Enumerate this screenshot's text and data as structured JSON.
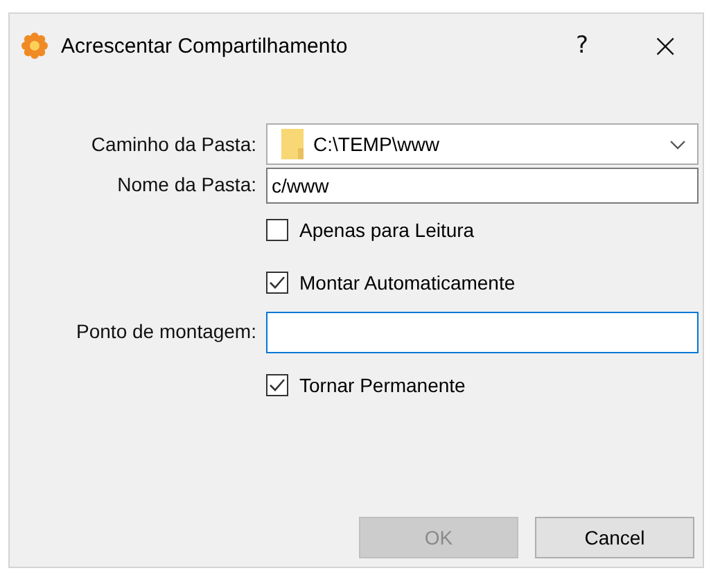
{
  "window": {
    "title": "Acrescentar Compartilhamento",
    "help": "?",
    "close": "×"
  },
  "form": [
    {
      "kind": "combo",
      "label": "Caminho da Pasta:",
      "value": "C:\\TEMP\\www",
      "focused": false
    },
    {
      "kind": "text",
      "label": "Nome da Pasta:",
      "value": "c/www",
      "focused": false
    },
    {
      "kind": "check",
      "label": "Apenas para Leitura",
      "checked": false
    },
    {
      "kind": "check",
      "label": "Montar Automaticamente",
      "checked": true
    },
    {
      "kind": "text",
      "label": "Ponto de montagem:",
      "focused": true
    },
    {
      "kind": "check",
      "label": "Tornar Permanente",
      "checked": true
    }
  ],
  "buttons": [
    {
      "label": "OK",
      "disabled": true
    },
    {
      "label": "Cancel",
      "disabled": false
    }
  ]
}
